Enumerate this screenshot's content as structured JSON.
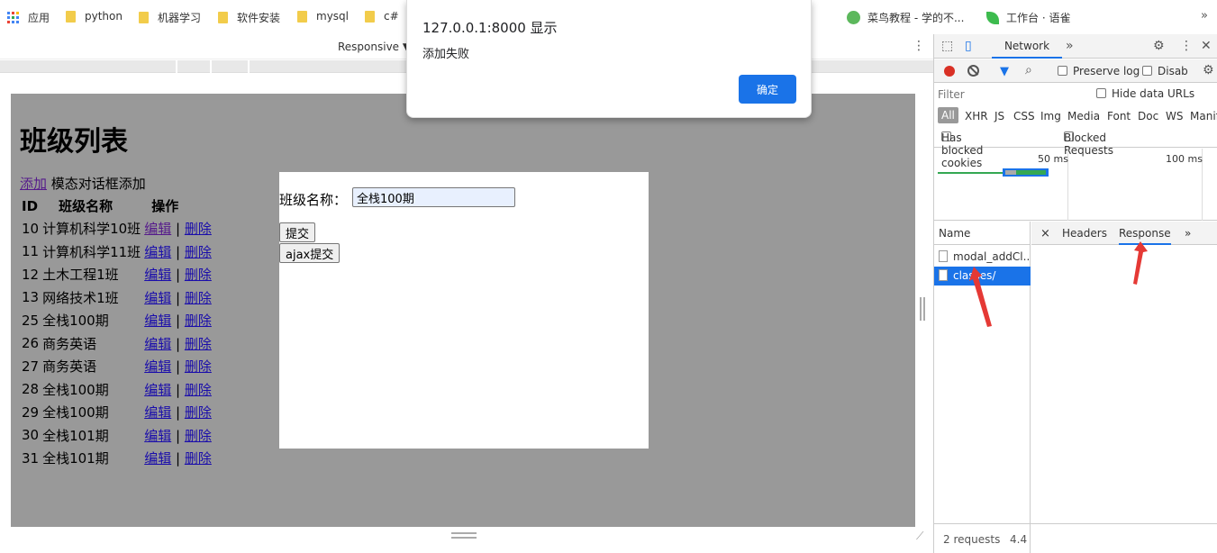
{
  "bookmarks": {
    "apps": "应用",
    "items": [
      "python",
      "机器学习",
      "软件安装",
      "mysql",
      "c#"
    ],
    "runoob": "菜鸟教程 - 学的不...",
    "yuque": "工作台 · 语雀",
    "more": "»"
  },
  "device_toolbar": {
    "mode": "Responsive ▼",
    "more": "⋮"
  },
  "dialog": {
    "title": "127.0.0.1:8000 显示",
    "message": "添加失败",
    "ok_label": "确定"
  },
  "page": {
    "title": "班级列表",
    "add_link": "添加",
    "modal_add_text": "模态对话框添加",
    "columns": [
      "ID",
      "班级名称",
      "操作"
    ],
    "edit_label": "编辑",
    "delete_label": "删除",
    "separator": "|",
    "rows": [
      {
        "id": "10",
        "name": "计算机科学10班"
      },
      {
        "id": "11",
        "name": "计算机科学11班"
      },
      {
        "id": "12",
        "name": "土木工程1班"
      },
      {
        "id": "13",
        "name": "网络技术1班"
      },
      {
        "id": "25",
        "name": "全栈100期"
      },
      {
        "id": "26",
        "name": "商务英语"
      },
      {
        "id": "27",
        "name": "商务英语"
      },
      {
        "id": "28",
        "name": "全栈100期"
      },
      {
        "id": "29",
        "name": "全栈100期"
      },
      {
        "id": "30",
        "name": "全栈101期"
      },
      {
        "id": "31",
        "name": "全栈101期"
      }
    ],
    "modal": {
      "label": "班级名称：",
      "value": "全栈100期",
      "submit": "提交",
      "ajax_submit": "ajax提交"
    }
  },
  "devtools": {
    "tab": "Network",
    "more_tabs": "»",
    "preserve_log": "Preserve log",
    "disable_cache": "Disab",
    "filter_placeholder": "Filter",
    "hide_data_urls": "Hide data URLs",
    "types": [
      "All",
      "XHR",
      "JS",
      "CSS",
      "Img",
      "Media",
      "Font",
      "Doc",
      "WS",
      "Manif"
    ],
    "has_blocked_cookies": "Has blocked cookies",
    "blocked_requests": "Blocked Requests",
    "timeline_labels": [
      "50 ms",
      "100 ms"
    ],
    "name_header": "Name",
    "requests": [
      "modal_addCl...",
      "classes/"
    ],
    "selected_request": "classes/",
    "detail_tabs": [
      "Headers",
      "Response"
    ],
    "active_detail_tab": "Response",
    "close": "×",
    "footer": "2 requests",
    "footer_size": "4.4"
  },
  "colors": {
    "accent": "#1a73e8",
    "record": "#d93025",
    "annotation_arrow": "#e53935",
    "page_bg": "#999999"
  }
}
